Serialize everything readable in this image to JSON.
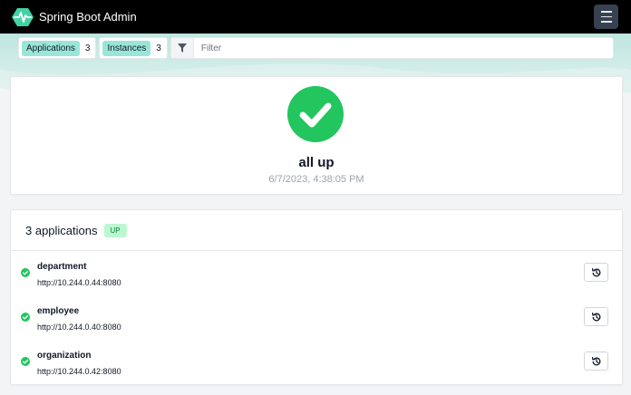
{
  "app": {
    "title": "Spring Boot Admin"
  },
  "toolbar": {
    "applications_label": "Applications",
    "applications_count": "3",
    "instances_label": "Instances",
    "instances_count": "3",
    "filter_placeholder": "Filter"
  },
  "status": {
    "title": "all up",
    "timestamp": "6/7/2023, 4:38:05 PM"
  },
  "applications": {
    "header": "3 applications",
    "status_badge": "UP",
    "items": [
      {
        "name": "department",
        "url": "http://10.244.0.44:8080"
      },
      {
        "name": "employee",
        "url": "http://10.244.0.40:8080"
      },
      {
        "name": "organization",
        "url": "http://10.244.0.42:8080"
      }
    ]
  },
  "colors": {
    "brand": "#42d3a5",
    "up_green": "#22c55e",
    "pill_teal": "#99e6d8",
    "navbar": "#000000"
  },
  "icons": {
    "logo": "heartbeat-hexagon-icon",
    "menu": "hamburger-menu-icon",
    "filter": "filter-funnel-icon",
    "status": "check-circle-icon",
    "row_status": "check-circle-icon",
    "history": "history-icon"
  }
}
